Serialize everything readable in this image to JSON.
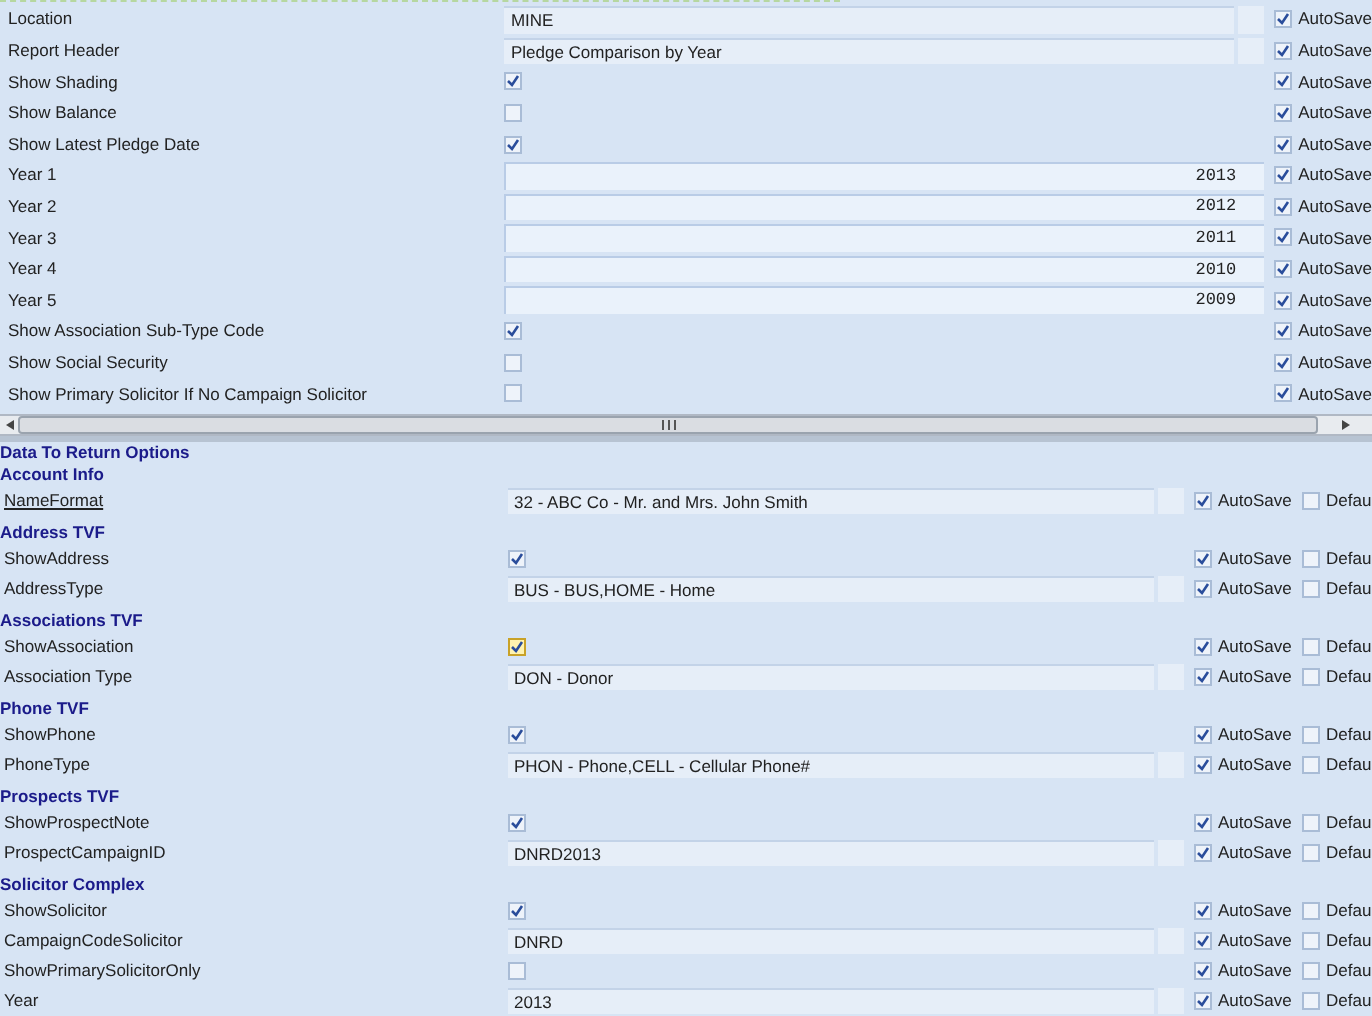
{
  "top_settings": [
    {
      "label": "Location",
      "kind": "text",
      "value": "MINE",
      "autosave": {
        "label": "AutoSave",
        "checked": true
      }
    },
    {
      "label": "Report Header",
      "kind": "text",
      "value": "Pledge Comparison by Year",
      "autosave": {
        "label": "AutoSave",
        "checked": true
      }
    },
    {
      "label": "Show Shading",
      "kind": "check",
      "checked": true,
      "autosave": {
        "label": "AutoSave",
        "checked": true
      }
    },
    {
      "label": "Show Balance",
      "kind": "check",
      "checked": false,
      "autosave": {
        "label": "AutoSave",
        "checked": true
      }
    },
    {
      "label": "Show Latest Pledge Date",
      "kind": "check",
      "checked": true,
      "autosave": {
        "label": "AutoSave",
        "checked": true
      }
    },
    {
      "label": "Year 1",
      "kind": "number",
      "value": "2013",
      "autosave": {
        "label": "AutoSave",
        "checked": true
      }
    },
    {
      "label": "Year 2",
      "kind": "number",
      "value": "2012",
      "autosave": {
        "label": "AutoSave",
        "checked": true
      }
    },
    {
      "label": "Year 3",
      "kind": "number",
      "value": "2011",
      "autosave": {
        "label": "AutoSave",
        "checked": true
      }
    },
    {
      "label": "Year 4",
      "kind": "number",
      "value": "2010",
      "autosave": {
        "label": "AutoSave",
        "checked": true
      }
    },
    {
      "label": "Year 5",
      "kind": "number",
      "value": "2009",
      "autosave": {
        "label": "AutoSave",
        "checked": true
      }
    },
    {
      "label": "Show Association Sub-Type Code",
      "kind": "check",
      "checked": true,
      "autosave": {
        "label": "AutoSave",
        "checked": true
      }
    },
    {
      "label": "Show Social Security",
      "kind": "check",
      "checked": false,
      "autosave": {
        "label": "AutoSave",
        "checked": true
      }
    },
    {
      "label": "Show Primary Solicitor If No Campaign Solicitor",
      "kind": "check",
      "checked": false,
      "autosave": {
        "label": "AutoSave",
        "checked": true
      }
    }
  ],
  "return_options": {
    "title": "Data To Return Options",
    "sections": [
      {
        "title": "Account Info",
        "rows": [
          {
            "label": "NameFormat",
            "link": true,
            "kind": "text",
            "value": "32 - ABC Co - Mr. and Mrs. John Smith",
            "autosave": {
              "label": "AutoSave",
              "checked": true
            },
            "default": {
              "label": "Defau",
              "checked": false
            }
          }
        ]
      },
      {
        "title": "Address TVF",
        "rows": [
          {
            "label": "ShowAddress",
            "link": false,
            "kind": "check",
            "checked": true,
            "focused": false,
            "autosave": {
              "label": "AutoSave",
              "checked": true
            },
            "default": {
              "label": "Defau",
              "checked": false
            }
          },
          {
            "label": "AddressType",
            "link": false,
            "kind": "text",
            "value": "BUS - BUS,HOME - Home",
            "autosave": {
              "label": "AutoSave",
              "checked": true
            },
            "default": {
              "label": "Defau",
              "checked": false
            }
          }
        ]
      },
      {
        "title": "Associations TVF",
        "rows": [
          {
            "label": "ShowAssociation",
            "link": false,
            "kind": "check",
            "checked": true,
            "focused": true,
            "autosave": {
              "label": "AutoSave",
              "checked": true
            },
            "default": {
              "label": "Defau",
              "checked": false
            }
          },
          {
            "label": "Association Type",
            "link": false,
            "kind": "text",
            "value": "DON - Donor",
            "autosave": {
              "label": "AutoSave",
              "checked": true
            },
            "default": {
              "label": "Defau",
              "checked": false
            }
          }
        ]
      },
      {
        "title": "Phone TVF",
        "rows": [
          {
            "label": "ShowPhone",
            "link": false,
            "kind": "check",
            "checked": true,
            "focused": false,
            "autosave": {
              "label": "AutoSave",
              "checked": true
            },
            "default": {
              "label": "Defau",
              "checked": false
            }
          },
          {
            "label": "PhoneType",
            "link": false,
            "kind": "text",
            "value": "PHON - Phone,CELL - Cellular Phone#",
            "autosave": {
              "label": "AutoSave",
              "checked": true
            },
            "default": {
              "label": "Defau",
              "checked": false
            }
          }
        ]
      },
      {
        "title": "Prospects TVF",
        "rows": [
          {
            "label": "ShowProspectNote",
            "link": false,
            "kind": "check",
            "checked": true,
            "focused": false,
            "autosave": {
              "label": "AutoSave",
              "checked": true
            },
            "default": {
              "label": "Defau",
              "checked": false
            }
          },
          {
            "label": "ProspectCampaignID",
            "link": false,
            "kind": "text",
            "value": "DNRD2013",
            "autosave": {
              "label": "AutoSave",
              "checked": true
            },
            "default": {
              "label": "Defau",
              "checked": false
            }
          }
        ]
      },
      {
        "title": "Solicitor Complex",
        "rows": [
          {
            "label": "ShowSolicitor",
            "link": false,
            "kind": "check",
            "checked": true,
            "focused": false,
            "autosave": {
              "label": "AutoSave",
              "checked": true
            },
            "default": {
              "label": "Defau",
              "checked": false
            }
          },
          {
            "label": "CampaignCodeSolicitor",
            "link": false,
            "kind": "text",
            "value": "DNRD",
            "autosave": {
              "label": "AutoSave",
              "checked": true
            },
            "default": {
              "label": "Defau",
              "checked": false
            }
          },
          {
            "label": "ShowPrimarySolicitorOnly",
            "link": false,
            "kind": "check",
            "checked": false,
            "focused": false,
            "autosave": {
              "label": "AutoSave",
              "checked": true
            },
            "default": {
              "label": "Defau",
              "checked": false
            }
          },
          {
            "label": "Year",
            "link": false,
            "kind": "text",
            "value": "2013",
            "autosave": {
              "label": "AutoSave",
              "checked": true
            },
            "default": {
              "label": "Defau",
              "checked": false
            }
          }
        ]
      }
    ]
  }
}
